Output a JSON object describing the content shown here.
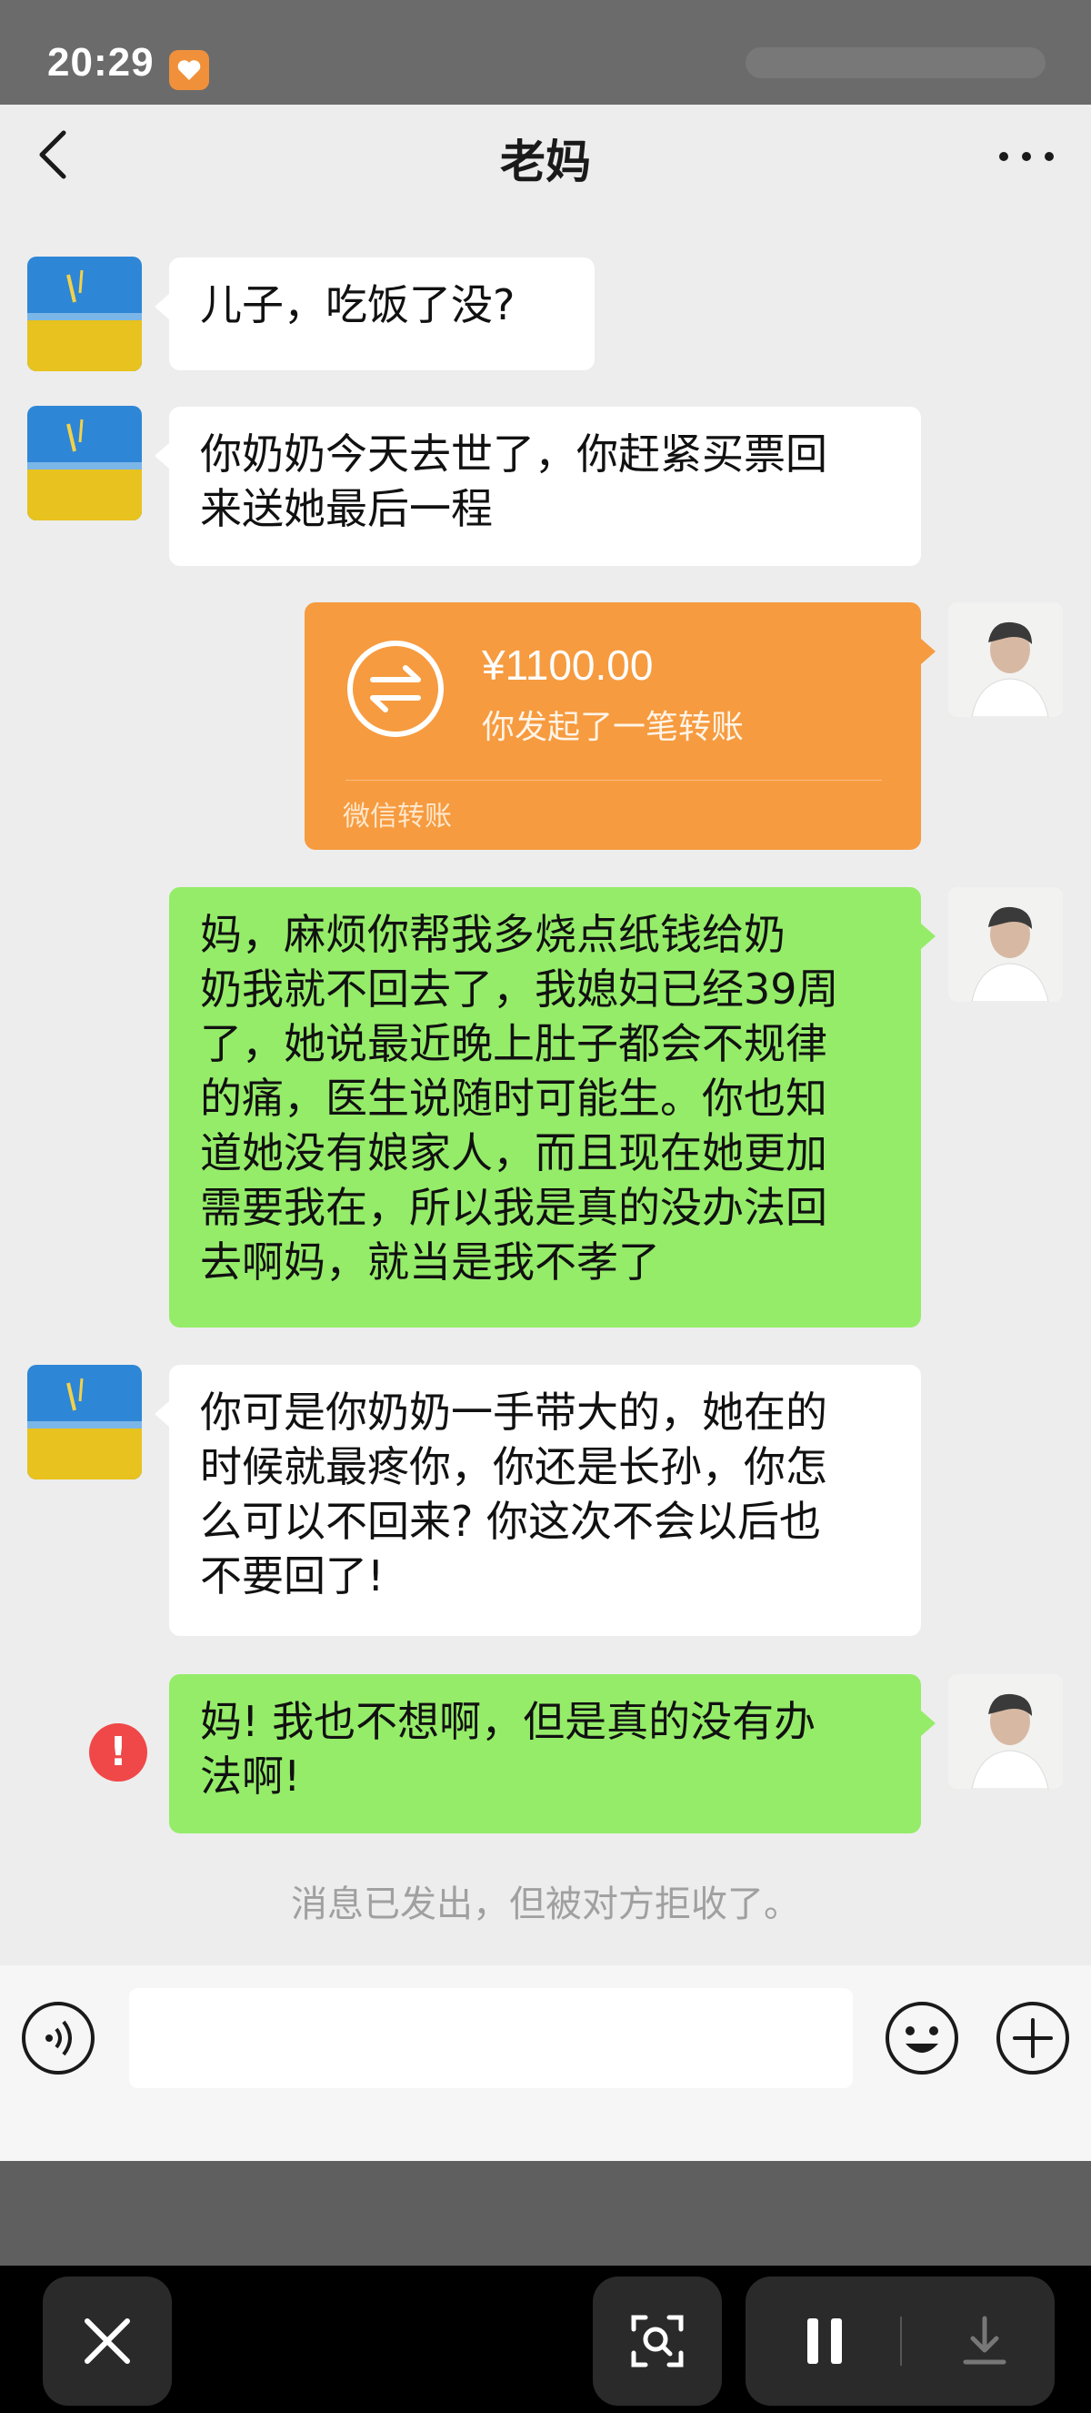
{
  "status_bar": {
    "time": "20:29"
  },
  "header": {
    "title": "老妈"
  },
  "messages": [
    {
      "id": "m1",
      "sender": "mom",
      "text": "儿子，吃饭了没?"
    },
    {
      "id": "m2",
      "sender": "mom",
      "text": "你奶奶今天去世了，你赶紧买票回\n来送她最后一程"
    },
    {
      "id": "m3",
      "sender": "me",
      "type": "transfer",
      "amount": "¥1100.00",
      "description": "你发起了一笔转账",
      "footer": "微信转账"
    },
    {
      "id": "m4",
      "sender": "me",
      "text": "妈，麻烦你帮我多烧点纸钱给奶\n奶我就不回去了，我媳妇已经39周\n了，她说最近晚上肚子都会不规律\n的痛，医生说随时可能生。你也知\n道她没有娘家人，而且现在她更加\n需要我在，所以我是真的没办法回\n去啊妈，就当是我不孝了"
    },
    {
      "id": "m5",
      "sender": "mom",
      "text": "你可是你奶奶一手带大的，她在的\n时候就最疼你，你还是长孙，你怎\n么可以不回来? 你这次不会以后也\n不要回了!"
    },
    {
      "id": "m6",
      "sender": "me",
      "text": "妈! 我也不想啊，但是真的没有办\n法啊!",
      "status": "failed",
      "error_icon": "!"
    }
  ],
  "system_message": "消息已发出，但被对方拒收了。",
  "input": {
    "placeholder": ""
  },
  "colors": {
    "chat_bg": "#ededed",
    "outgoing": "#95ec69",
    "incoming": "#ffffff",
    "transfer": "#f69b3f",
    "error": "#f04848"
  },
  "icons": [
    "back-arrow-icon",
    "more-icon",
    "voice-icon",
    "emoji-icon",
    "plus-icon",
    "close-icon",
    "scan-icon",
    "pause-icon",
    "download-icon",
    "transfer-icon",
    "error-icon"
  ]
}
